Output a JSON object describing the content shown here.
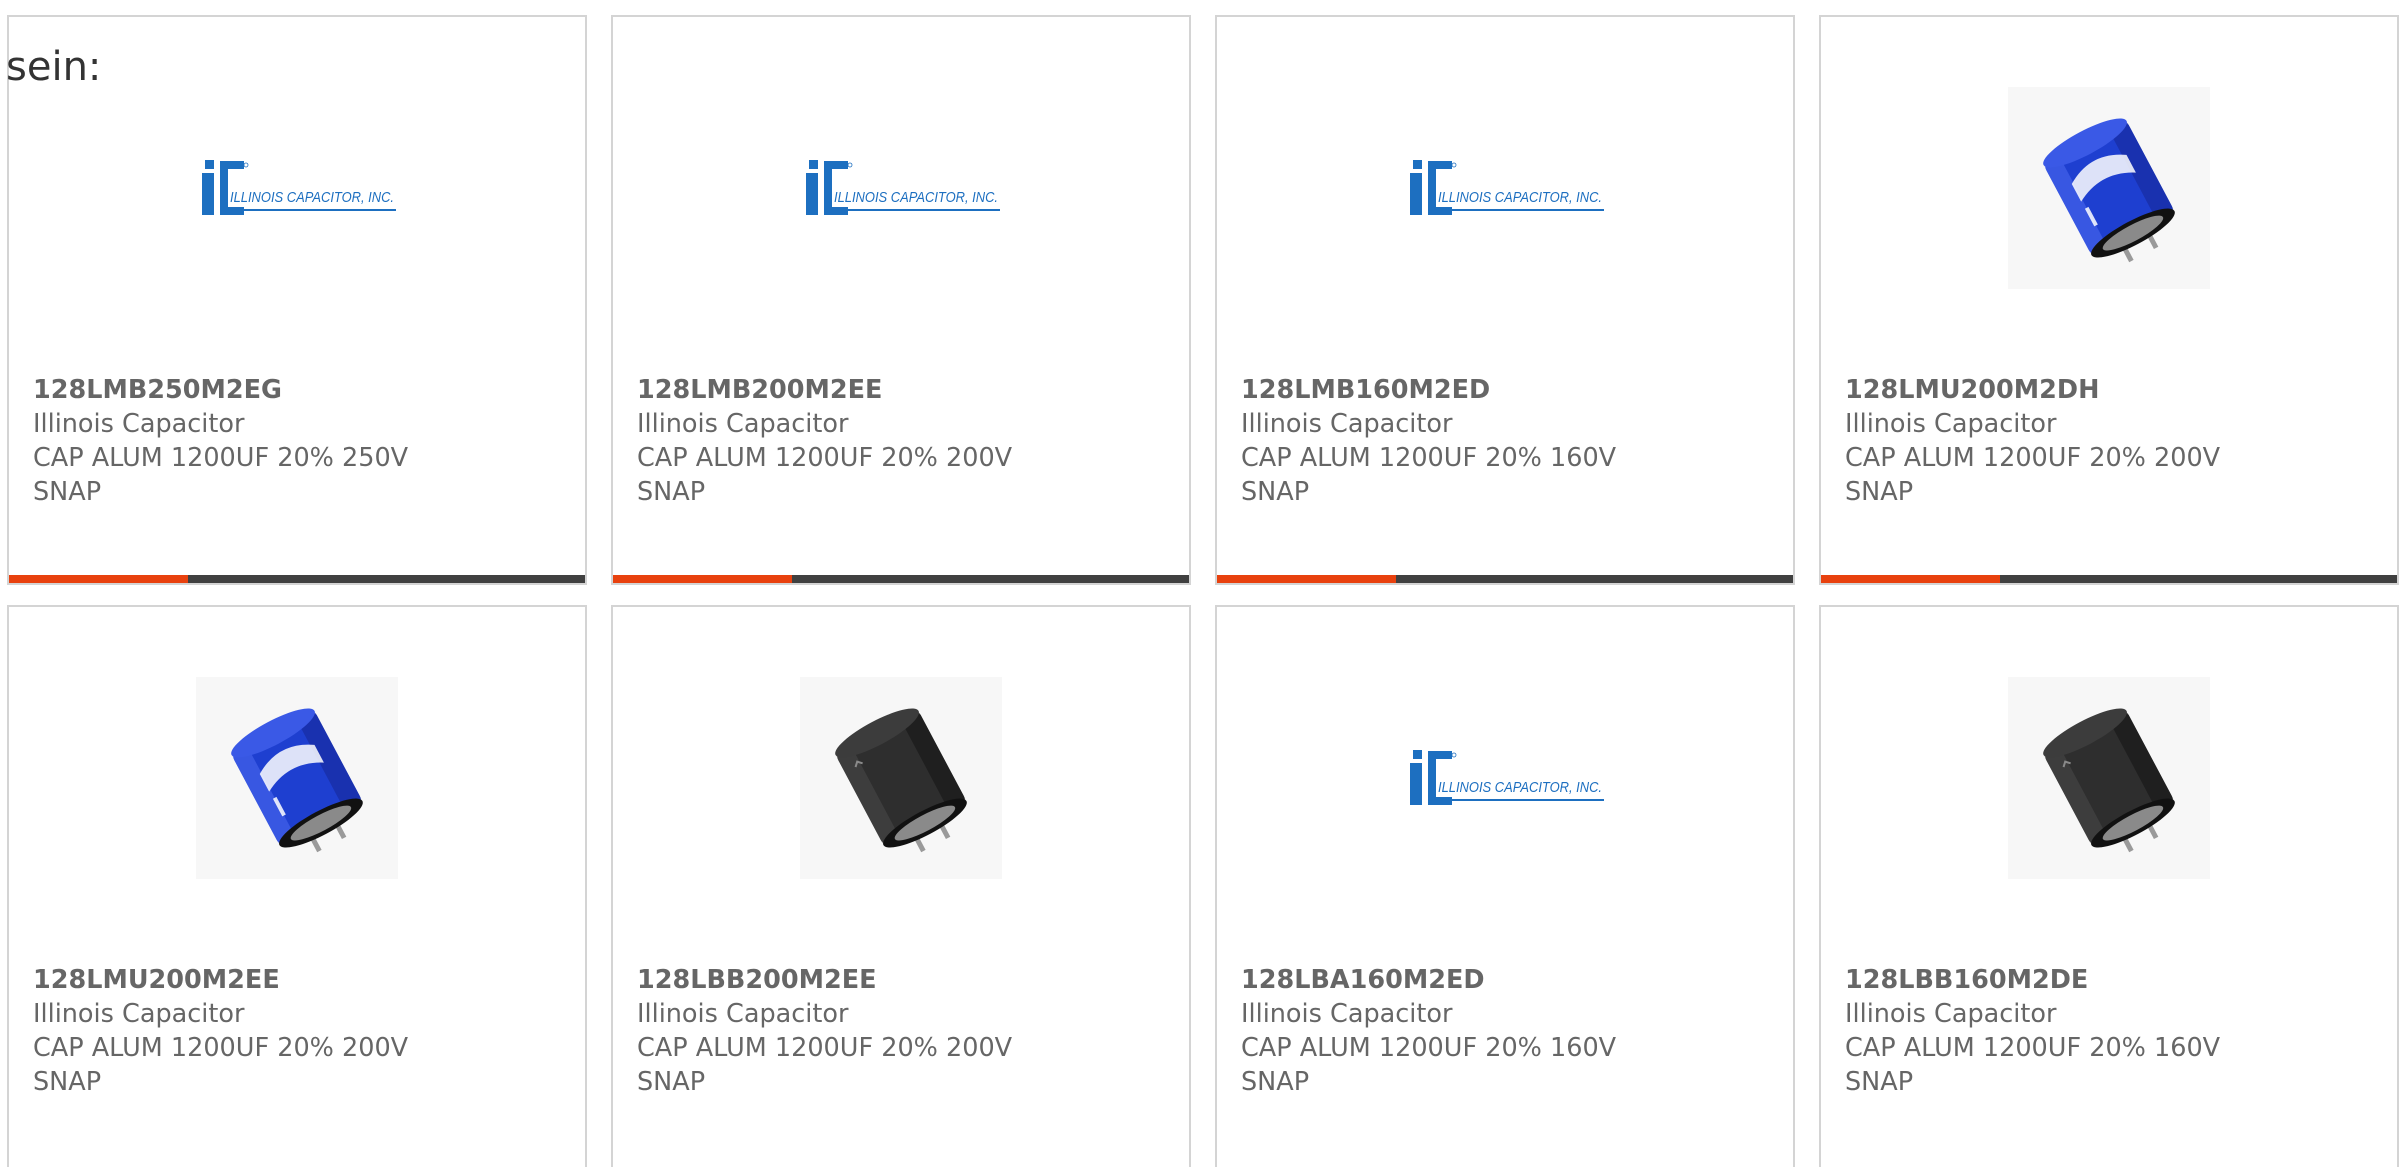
{
  "intro_text": "sein:",
  "colors": {
    "card_border": "#d4d4d4",
    "text": "#666666",
    "progress_track": "#404040",
    "progress_fill": "#e8410e",
    "logo_blue": "#1d6fc0",
    "capacitor_blue": "#1e3fd0"
  },
  "products": [
    {
      "part_number": "128LMB250M2EG",
      "manufacturer": "Illinois Capacitor",
      "description_line1": "CAP ALUM 1200UF 20% 250V",
      "description_line2": "SNAP",
      "image": "ic-logo",
      "logo_text": "ILLINOIS CAPACITOR, INC.",
      "progress_fraction": 0.31
    },
    {
      "part_number": "128LMB200M2EE",
      "manufacturer": "Illinois Capacitor",
      "description_line1": "CAP ALUM 1200UF 20% 200V",
      "description_line2": "SNAP",
      "image": "ic-logo",
      "logo_text": "ILLINOIS CAPACITOR, INC.",
      "progress_fraction": 0.31
    },
    {
      "part_number": "128LMB160M2ED",
      "manufacturer": "Illinois Capacitor",
      "description_line1": "CAP ALUM 1200UF 20% 160V",
      "description_line2": "SNAP",
      "image": "ic-logo",
      "logo_text": "ILLINOIS CAPACITOR, INC.",
      "progress_fraction": 0.31
    },
    {
      "part_number": "128LMU200M2DH",
      "manufacturer": "Illinois Capacitor",
      "description_line1": "CAP ALUM 1200UF 20% 200V",
      "description_line2": "SNAP",
      "image": "blue-capacitor",
      "progress_fraction": 0.31
    },
    {
      "part_number": "128LMU200M2EE",
      "manufacturer": "Illinois Capacitor",
      "description_line1": "CAP ALUM 1200UF 20% 200V",
      "description_line2": "SNAP",
      "image": "blue-capacitor"
    },
    {
      "part_number": "128LBB200M2EE",
      "manufacturer": "Illinois Capacitor",
      "description_line1": "CAP ALUM 1200UF 20% 200V",
      "description_line2": "SNAP",
      "image": "black-capacitor"
    },
    {
      "part_number": "128LBA160M2ED",
      "manufacturer": "Illinois Capacitor",
      "description_line1": "CAP ALUM 1200UF 20% 160V",
      "description_line2": "SNAP",
      "image": "ic-logo",
      "logo_text": "ILLINOIS CAPACITOR, INC."
    },
    {
      "part_number": "128LBB160M2DE",
      "manufacturer": "Illinois Capacitor",
      "description_line1": "CAP ALUM 1200UF 20% 160V",
      "description_line2": "SNAP",
      "image": "black-capacitor"
    }
  ]
}
